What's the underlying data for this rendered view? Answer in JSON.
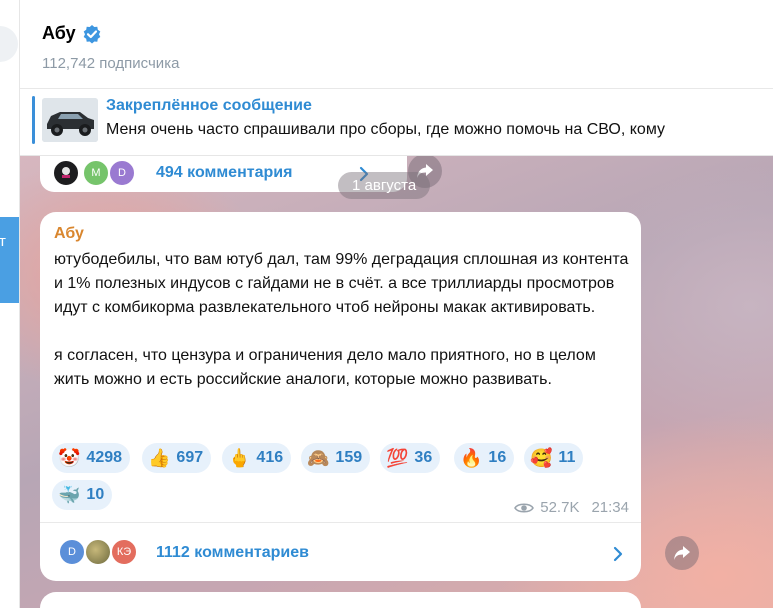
{
  "channel": {
    "name": "Абу",
    "subscribers": "112,742 подписчика"
  },
  "left_list": {
    "selected_fragment": "т"
  },
  "pinned": {
    "title": "Закреплённое сообщение",
    "text": "Меня очень часто спрашивали про сборы, где можно помочь на СВО, кому"
  },
  "previous_post": {
    "comments_label": "494 комментария",
    "avatars": [
      "",
      "M",
      "D"
    ]
  },
  "date_separator": "1 августа",
  "post": {
    "author": "Абу",
    "text": "ютубодебилы, что вам ютуб дал, там 99% деградация сплошная из контента и 1% полезных индусов с гайдами не в счёт. а все триллиарды просмотров идут с комбикорма развлекательного чтоб нейроны макак активировать.\n\nя согласен, что цензура и ограничения дело мало приятного, но в целом жить можно и есть российские аналоги, которые можно развивать.",
    "reactions": [
      {
        "emoji": "🤡",
        "count": "4298"
      },
      {
        "emoji": "👍",
        "count": "697"
      },
      {
        "emoji": "🖕",
        "count": "416"
      },
      {
        "emoji": "🙈",
        "count": "159"
      },
      {
        "emoji": "💯",
        "count": "36"
      },
      {
        "emoji": "🔥",
        "count": "16"
      },
      {
        "emoji": "🥰",
        "count": "11"
      },
      {
        "emoji": "🐳",
        "count": "10"
      }
    ],
    "views": "52.7K",
    "time": "21:34",
    "comments_label": "1112 комментариев",
    "comment_avatars": [
      "D",
      "",
      "КЭ"
    ]
  },
  "colors": {
    "accent": "#2f8bd3",
    "author": "#d9862e",
    "reaction_bg": "#e7f1fb"
  },
  "icons": [
    "verified-icon",
    "chevron-right-icon",
    "share-icon",
    "eye-icon"
  ]
}
